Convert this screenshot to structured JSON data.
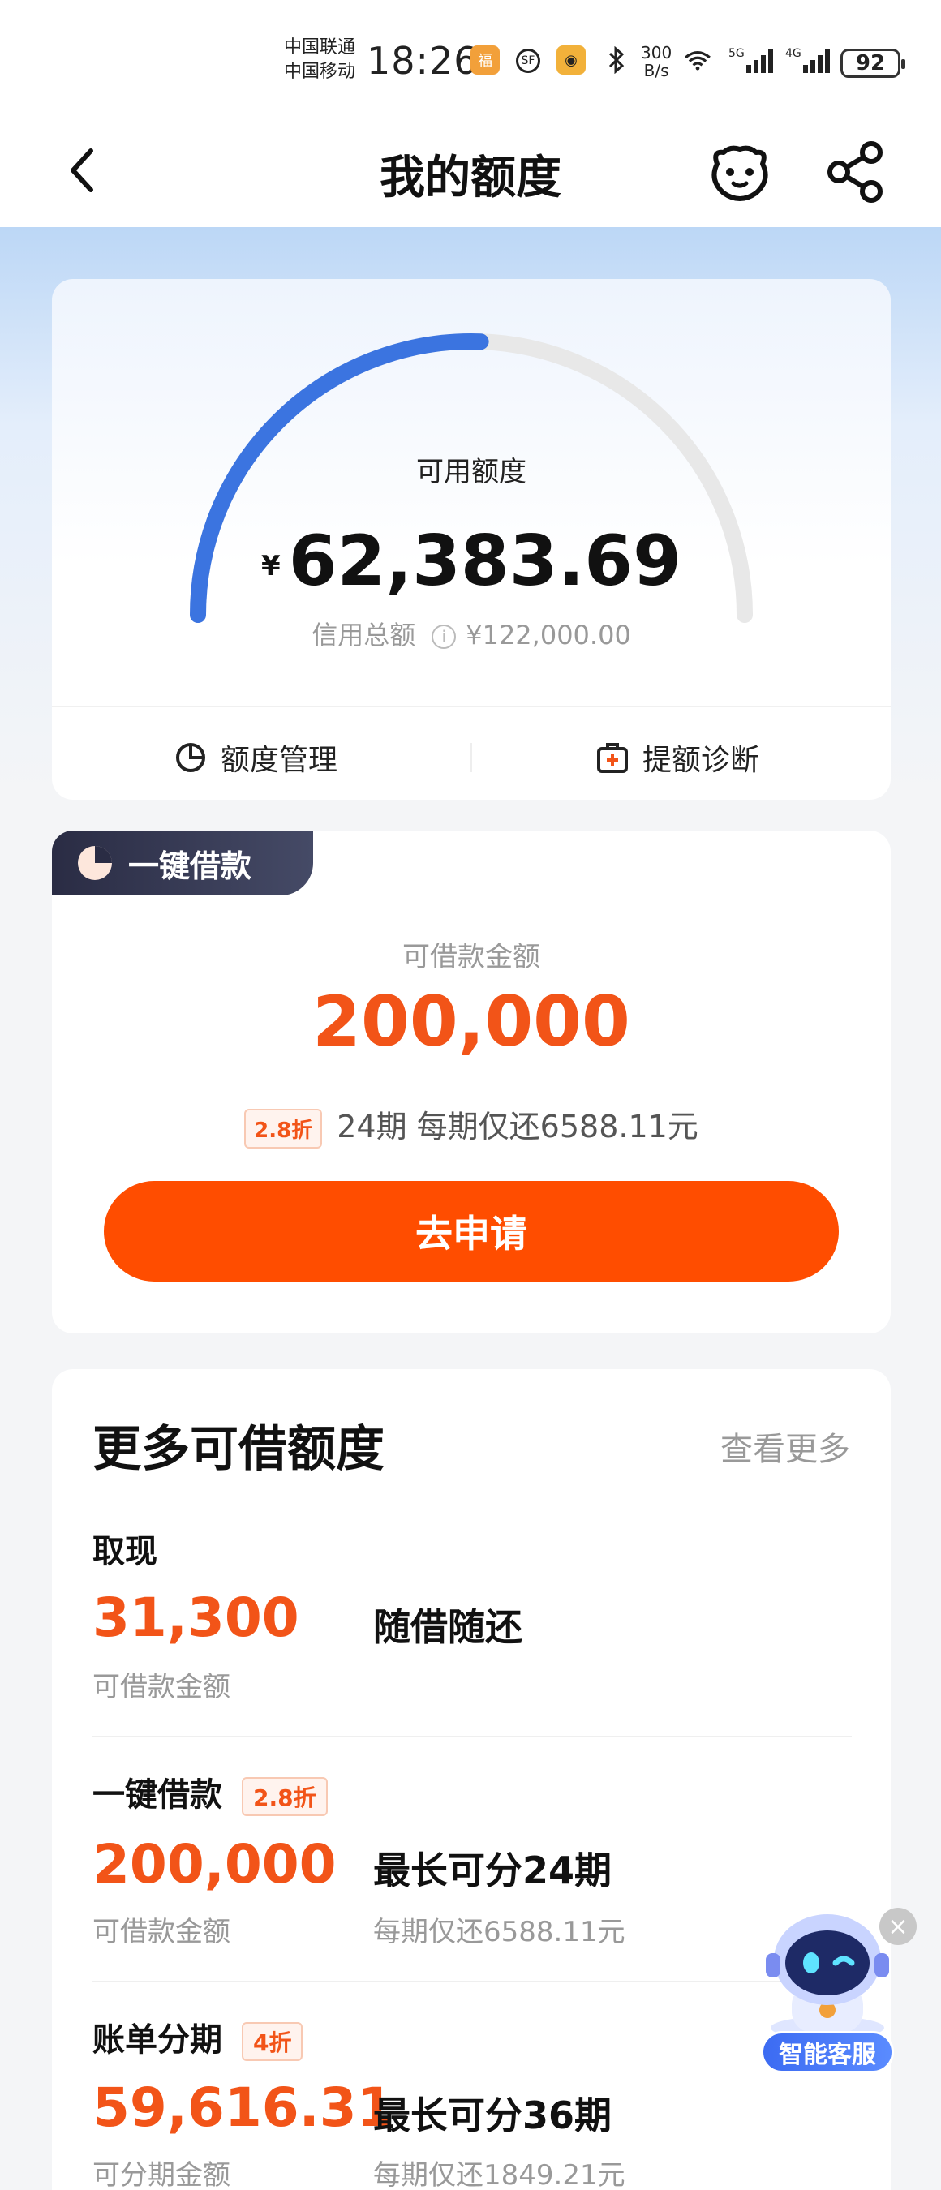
{
  "status_bar": {
    "carrier_1": "中国联通",
    "carrier_2": "中国移动",
    "time": "18:26",
    "net_speed_value": "300",
    "net_speed_unit": "B/s",
    "wifi_label": "6",
    "signal_1": "5G",
    "signal_2": "4G",
    "battery": "92"
  },
  "nav": {
    "title": "我的额度"
  },
  "credit": {
    "available_label": "可用额度",
    "currency": "¥",
    "available_amount": "62,383.69",
    "total_label": "信用总额",
    "total_amount": "¥122,000.00",
    "available_ratio": 0.511,
    "actions": {
      "manage_label": "额度管理",
      "diagnose_label": "提额诊断"
    }
  },
  "loan": {
    "tag": "一键借款",
    "amount_label": "可借款金额",
    "amount": "200,000",
    "discount": "2.8折",
    "terms": "24期 每期仅还6588.11元",
    "apply_button": "去申请"
  },
  "more": {
    "title": "更多可借额度",
    "view_more": "查看更多",
    "items": [
      {
        "name": "取现",
        "amount": "31,300",
        "amount_label": "可借款金额",
        "desc": "随借随还"
      },
      {
        "name": "一键借款",
        "badge": "2.8折",
        "amount": "200,000",
        "amount_label": "可借款金额",
        "desc": "最长可分24期",
        "desc_sub": "每期仅还6588.11元"
      },
      {
        "name": "账单分期",
        "badge": "4折",
        "amount": "59,616.31",
        "amount_label": "可分期金额",
        "desc": "最长可分36期",
        "desc_sub": "每期仅还1849.21元"
      }
    ]
  },
  "customer_service": {
    "label": "智能客服",
    "close": "×"
  },
  "colors": {
    "accent_orange": "#f25418",
    "button_orange": "#ff4d00",
    "gauge_blue": "#3b74e0",
    "gauge_track": "#e8e8e8"
  }
}
